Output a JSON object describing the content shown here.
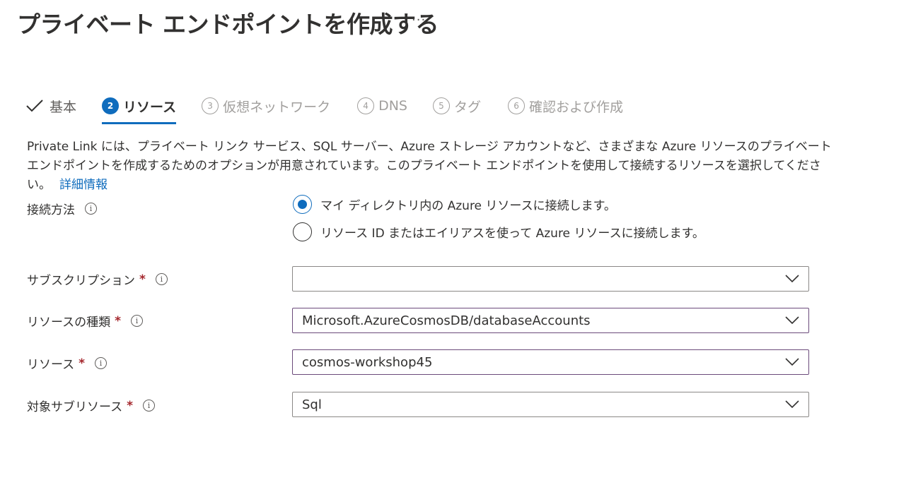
{
  "header": {
    "title": "プライベート エンドポイントを作成する",
    "more_label": "···"
  },
  "tabs": [
    {
      "label": "基本",
      "step": "",
      "state": "completed"
    },
    {
      "label": "リソース",
      "step": "2",
      "state": "active"
    },
    {
      "label": "仮想ネットワーク",
      "step": "3",
      "state": "disabled"
    },
    {
      "label": "DNS",
      "step": "4",
      "state": "disabled"
    },
    {
      "label": "タグ",
      "step": "5",
      "state": "disabled"
    },
    {
      "label": "確認および作成",
      "step": "6",
      "state": "disabled"
    }
  ],
  "description": {
    "text": "Private Link には、プライベート リンク サービス、SQL サーバー、Azure ストレージ アカウントなど、さまざまな Azure リソースのプライベート エンドポイントを作成するためのオプションが用意されています。このプライベート エンドポイントを使用して接続するリソースを選択してください。",
    "link": "詳細情報"
  },
  "form": {
    "connection_method": {
      "label": "接続方法",
      "options": [
        {
          "label": "マイ ディレクトリ内の Azure リソースに接続します。",
          "checked": true
        },
        {
          "label": "リソース ID またはエイリアスを使って Azure リソースに接続します。",
          "checked": false
        }
      ]
    },
    "subscription": {
      "label": "サブスクリプション",
      "required": "*",
      "value": ""
    },
    "resource_type": {
      "label": "リソースの種類",
      "required": "*",
      "value": "Microsoft.AzureCosmosDB/databaseAccounts"
    },
    "resource": {
      "label": "リソース",
      "required": "*",
      "value": "cosmos-workshop45"
    },
    "target_subresource": {
      "label": "対象サブリソース",
      "required": "*",
      "value": "Sql"
    }
  },
  "icons": {
    "info": "info-icon",
    "dropdown": "chevron-down-icon",
    "completed": "checkmark-icon"
  },
  "colors": {
    "accent": "#0f6cbd",
    "required": "#a4262c",
    "text": "#323130",
    "disabled": "#a19f9d"
  }
}
